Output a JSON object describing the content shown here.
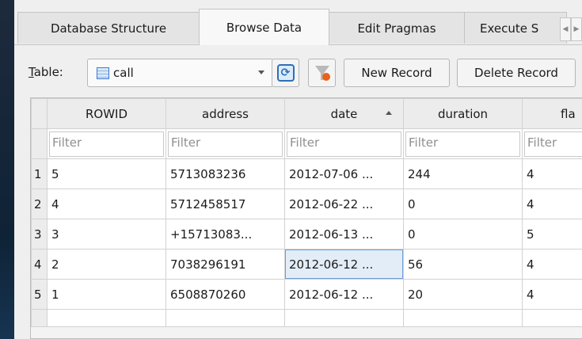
{
  "tabs": {
    "items": [
      "Database Structure",
      "Browse Data",
      "Edit Pragmas",
      "Execute S"
    ],
    "active": "Browse Data"
  },
  "toolbar": {
    "table_label": "Table:",
    "table_select": "call",
    "new_record": "New Record",
    "delete_record": "Delete Record"
  },
  "grid": {
    "columns": [
      "ROWID",
      "address",
      "date",
      "duration",
      "fla"
    ],
    "sorted_column": "date",
    "sort_direction": "ascending",
    "filter_placeholder": "Filter",
    "rows": [
      {
        "num": "1",
        "cells": [
          "5",
          "5713083236",
          "2012-07-06 ...",
          "244",
          "4"
        ]
      },
      {
        "num": "2",
        "cells": [
          "4",
          "5712458517",
          "2012-06-22 ...",
          "0",
          "4"
        ]
      },
      {
        "num": "3",
        "cells": [
          "3",
          "+15713083...",
          "2012-06-13 ...",
          "0",
          "5"
        ]
      },
      {
        "num": "4",
        "cells": [
          "2",
          "7038296191",
          "2012-06-12 ...",
          "56",
          "4"
        ]
      },
      {
        "num": "5",
        "cells": [
          "1",
          "6508870260",
          "2012-06-12 ...",
          "20",
          "4"
        ]
      }
    ],
    "selected_cell": {
      "row": 4,
      "column": "date"
    }
  },
  "colors": {
    "selection": "#e3edf8",
    "accent": "#2e6fb6",
    "clear_filter": "#e8601c"
  }
}
